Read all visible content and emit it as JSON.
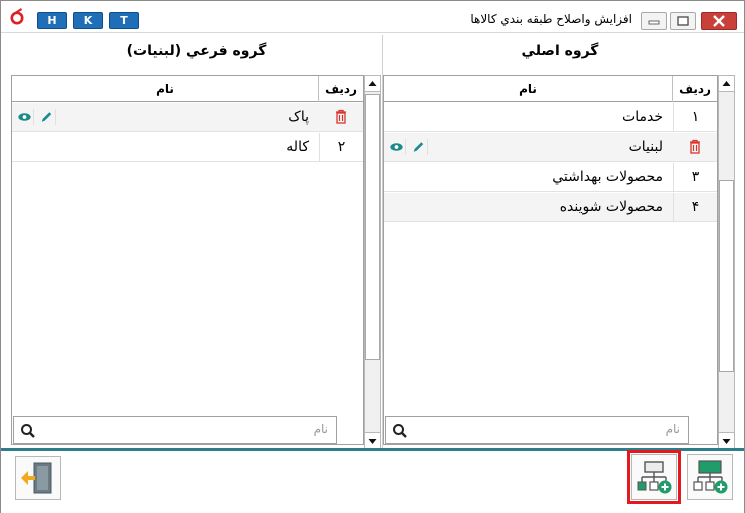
{
  "window": {
    "title": "افزايش واصلاح طبقه بندي كالاها",
    "shortcut_keys": [
      "H",
      "K",
      "T"
    ]
  },
  "left_panel": {
    "title": "گروه فرعي (لبنيات)",
    "columns": {
      "rank": "رديف",
      "name": "نام"
    },
    "rows": [
      {
        "rank": "",
        "name": "پاک",
        "editing": true
      },
      {
        "rank": "٢",
        "name": "كاله"
      }
    ],
    "search": {
      "placeholder": "نام",
      "value": ""
    }
  },
  "right_panel": {
    "title": "گروه اصلي",
    "columns": {
      "rank": "رديف",
      "name": "نام"
    },
    "rows": [
      {
        "rank": "١",
        "name": "خدمات"
      },
      {
        "rank": "",
        "name": "لبنيات",
        "editing": true
      },
      {
        "rank": "٣",
        "name": "محصولات بهداشتي"
      },
      {
        "rank": "۴",
        "name": "محصولات شوينده"
      }
    ],
    "search": {
      "placeholder": "نام",
      "value": ""
    }
  },
  "colors": {
    "accent": "#2d7d8a",
    "delete": "#d9342b",
    "action": "#1a8a8a",
    "highlight": "#e3191e",
    "group_add": "#1f9c6a"
  },
  "icons": {
    "exit": "exit-door-icon",
    "add_sub_group": "add-sub-group-icon",
    "add_main_group": "add-main-group-icon"
  }
}
